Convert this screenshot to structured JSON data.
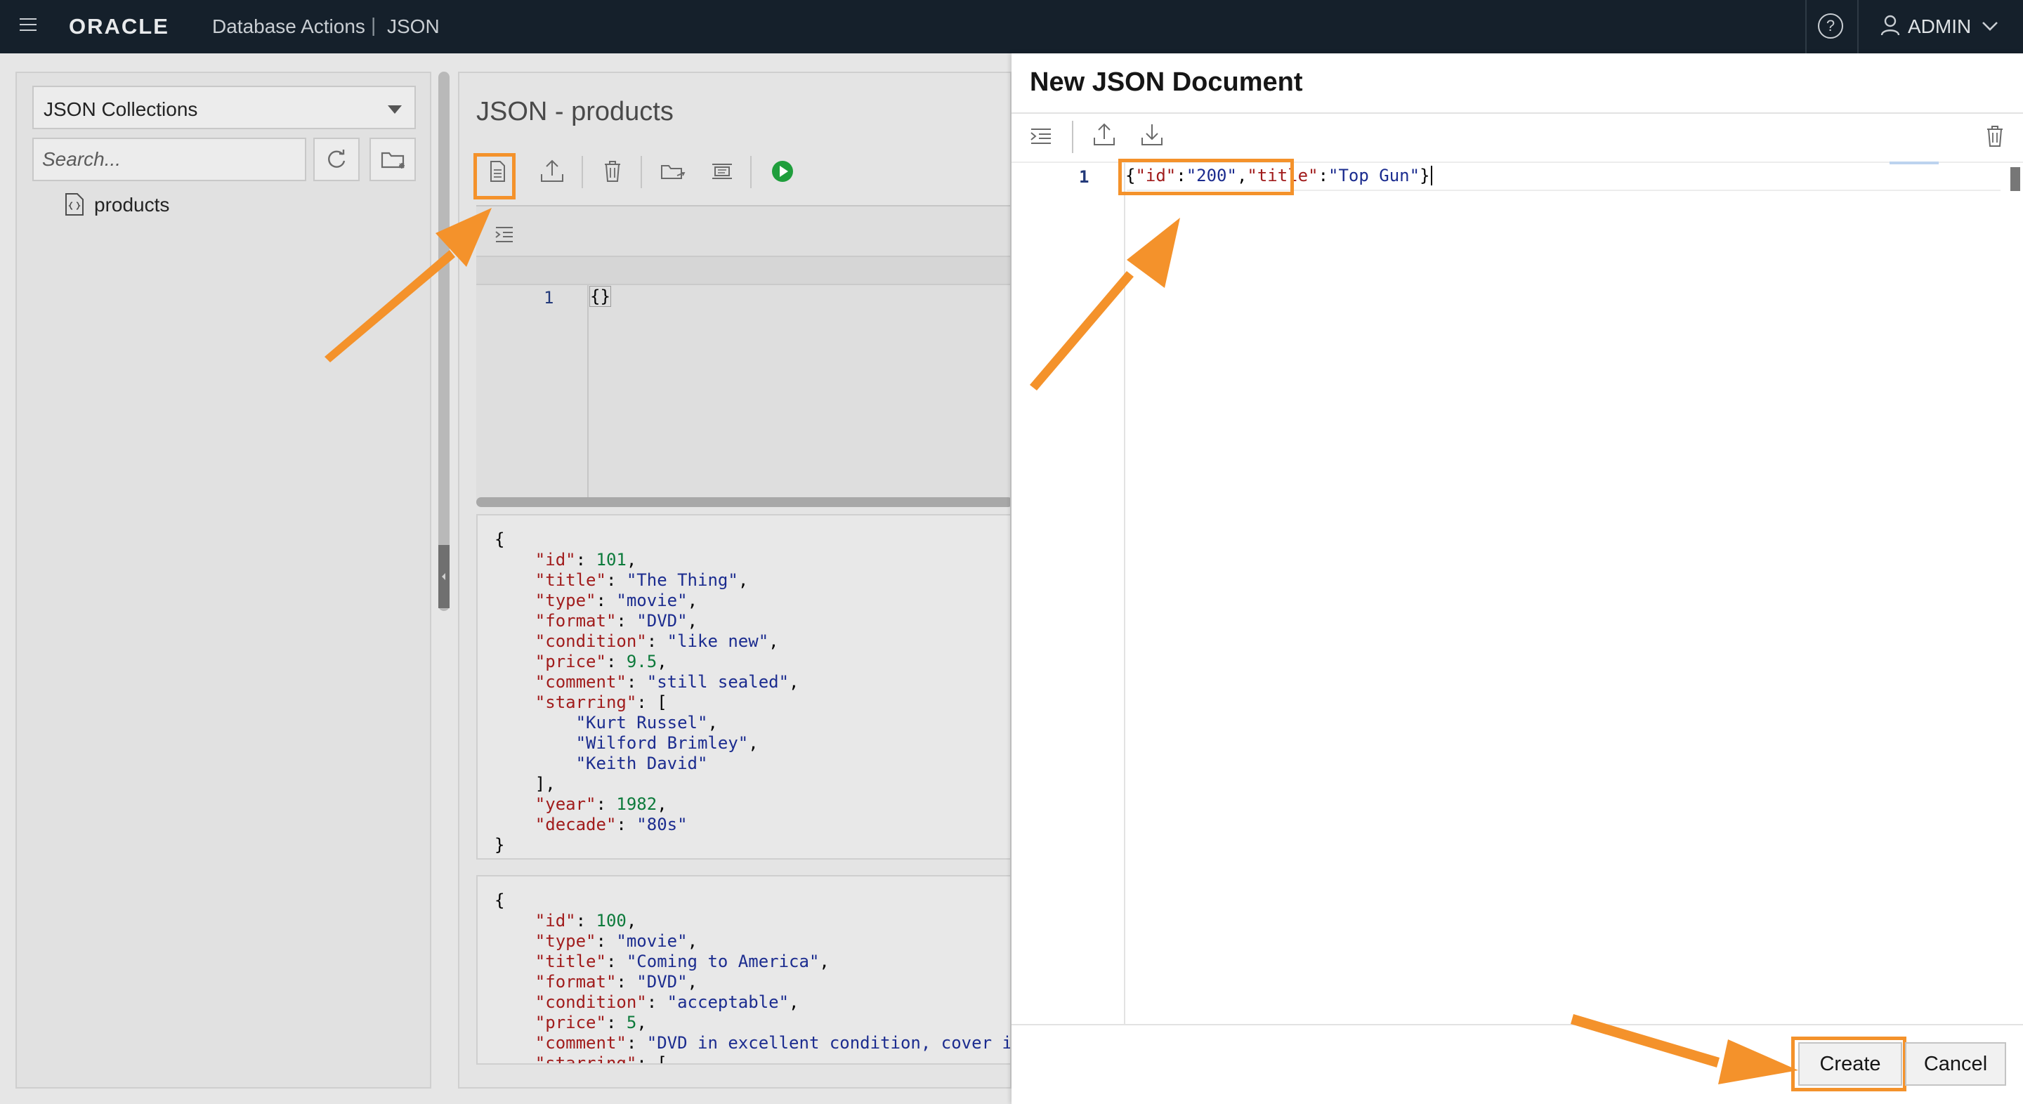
{
  "header": {
    "brand_logo": "ORACLE",
    "app_name": "Database Actions",
    "separator": "|",
    "module": "JSON",
    "user": "ADMIN"
  },
  "sidebar": {
    "collection_select": "JSON Collections",
    "search_placeholder": "Search...",
    "items": [
      {
        "label": "products"
      }
    ]
  },
  "main": {
    "title": "JSON - products",
    "editor": {
      "line_numbers": [
        "1"
      ],
      "code": "{}"
    },
    "documents": [
      {
        "lines": [
          [
            [
              "p",
              "{"
            ]
          ],
          [
            [
              "p",
              "    "
            ],
            [
              "k",
              "\"id\""
            ],
            [
              "p",
              ": "
            ],
            [
              "n",
              "101"
            ],
            [
              "p",
              ","
            ]
          ],
          [
            [
              "p",
              "    "
            ],
            [
              "k",
              "\"title\""
            ],
            [
              "p",
              ": "
            ],
            [
              "s",
              "\"The Thing\""
            ],
            [
              "p",
              ","
            ]
          ],
          [
            [
              "p",
              "    "
            ],
            [
              "k",
              "\"type\""
            ],
            [
              "p",
              ": "
            ],
            [
              "s",
              "\"movie\""
            ],
            [
              "p",
              ","
            ]
          ],
          [
            [
              "p",
              "    "
            ],
            [
              "k",
              "\"format\""
            ],
            [
              "p",
              ": "
            ],
            [
              "s",
              "\"DVD\""
            ],
            [
              "p",
              ","
            ]
          ],
          [
            [
              "p",
              "    "
            ],
            [
              "k",
              "\"condition\""
            ],
            [
              "p",
              ": "
            ],
            [
              "s",
              "\"like new\""
            ],
            [
              "p",
              ","
            ]
          ],
          [
            [
              "p",
              "    "
            ],
            [
              "k",
              "\"price\""
            ],
            [
              "p",
              ": "
            ],
            [
              "n",
              "9.5"
            ],
            [
              "p",
              ","
            ]
          ],
          [
            [
              "p",
              "    "
            ],
            [
              "k",
              "\"comment\""
            ],
            [
              "p",
              ": "
            ],
            [
              "s",
              "\"still sealed\""
            ],
            [
              "p",
              ","
            ]
          ],
          [
            [
              "p",
              "    "
            ],
            [
              "k",
              "\"starring\""
            ],
            [
              "p",
              ": ["
            ]
          ],
          [
            [
              "p",
              "        "
            ],
            [
              "s",
              "\"Kurt Russel\""
            ],
            [
              "p",
              ","
            ]
          ],
          [
            [
              "p",
              "        "
            ],
            [
              "s",
              "\"Wilford Brimley\""
            ],
            [
              "p",
              ","
            ]
          ],
          [
            [
              "p",
              "        "
            ],
            [
              "s",
              "\"Keith David\""
            ]
          ],
          [
            [
              "p",
              "    ],"
            ]
          ],
          [
            [
              "p",
              "    "
            ],
            [
              "k",
              "\"year\""
            ],
            [
              "p",
              ": "
            ],
            [
              "n",
              "1982"
            ],
            [
              "p",
              ","
            ]
          ],
          [
            [
              "p",
              "    "
            ],
            [
              "k",
              "\"decade\""
            ],
            [
              "p",
              ": "
            ],
            [
              "s",
              "\"80s\""
            ]
          ],
          [
            [
              "p",
              "}"
            ]
          ]
        ]
      },
      {
        "lines": [
          [
            [
              "p",
              "{"
            ]
          ],
          [
            [
              "p",
              "    "
            ],
            [
              "k",
              "\"id\""
            ],
            [
              "p",
              ": "
            ],
            [
              "n",
              "100"
            ],
            [
              "p",
              ","
            ]
          ],
          [
            [
              "p",
              "    "
            ],
            [
              "k",
              "\"type\""
            ],
            [
              "p",
              ": "
            ],
            [
              "s",
              "\"movie\""
            ],
            [
              "p",
              ","
            ]
          ],
          [
            [
              "p",
              "    "
            ],
            [
              "k",
              "\"title\""
            ],
            [
              "p",
              ": "
            ],
            [
              "s",
              "\"Coming to America\""
            ],
            [
              "p",
              ","
            ]
          ],
          [
            [
              "p",
              "    "
            ],
            [
              "k",
              "\"format\""
            ],
            [
              "p",
              ": "
            ],
            [
              "s",
              "\"DVD\""
            ],
            [
              "p",
              ","
            ]
          ],
          [
            [
              "p",
              "    "
            ],
            [
              "k",
              "\"condition\""
            ],
            [
              "p",
              ": "
            ],
            [
              "s",
              "\"acceptable\""
            ],
            [
              "p",
              ","
            ]
          ],
          [
            [
              "p",
              "    "
            ],
            [
              "k",
              "\"price\""
            ],
            [
              "p",
              ": "
            ],
            [
              "n",
              "5"
            ],
            [
              "p",
              ","
            ]
          ],
          [
            [
              "p",
              "    "
            ],
            [
              "k",
              "\"comment\""
            ],
            [
              "p",
              ": "
            ],
            [
              "s",
              "\"DVD in excellent condition, cover i"
            ]
          ],
          [
            [
              "p",
              "    "
            ],
            [
              "k",
              "\"starring\""
            ],
            [
              "p",
              ": ["
            ]
          ]
        ]
      }
    ]
  },
  "modal": {
    "title": "New JSON Document",
    "line_number": "1",
    "code_tokens": [
      [
        "p",
        "{"
      ],
      [
        "k",
        "\"id\""
      ],
      [
        "p",
        ":"
      ],
      [
        "s",
        "\"200\""
      ],
      [
        "p",
        ","
      ],
      [
        "k",
        "\"title\""
      ],
      [
        "p",
        ":"
      ],
      [
        "s",
        "\"Top Gun\""
      ],
      [
        "p",
        "}"
      ]
    ],
    "create_label": "Create",
    "cancel_label": "Cancel"
  },
  "colors": {
    "topbar": "#15202b",
    "highlight": "#f4922b",
    "json_key": "#a11c1c",
    "json_string": "#1b2c8f",
    "json_number": "#0c7a3b",
    "run_button": "#1f9e3c"
  },
  "icons": [
    "menu-icon",
    "help-icon",
    "user-icon",
    "chevron-down-icon",
    "refresh-icon",
    "new-folder-icon",
    "document-icon",
    "new-document-icon",
    "upload-icon",
    "download-icon",
    "trash-icon",
    "folder-open-icon",
    "query-builder-icon",
    "run-icon",
    "format-icon"
  ]
}
